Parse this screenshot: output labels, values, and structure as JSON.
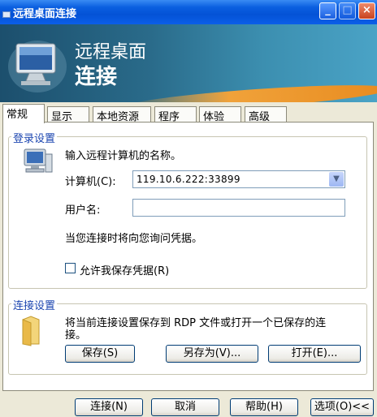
{
  "window": {
    "title": "远程桌面连接"
  },
  "banner": {
    "line1": "远程桌面",
    "line2": "连接"
  },
  "tabs": [
    {
      "label": "常规",
      "active": true
    },
    {
      "label": "显示",
      "active": false
    },
    {
      "label": "本地资源",
      "active": false
    },
    {
      "label": "程序",
      "active": false
    },
    {
      "label": "体验",
      "active": false
    },
    {
      "label": "高级",
      "active": false
    }
  ],
  "login": {
    "group_title": "登录设置",
    "instruction": "输入远程计算机的名称。",
    "computer_label": "计算机(C):",
    "computer_value": "119.10.6.222:33899",
    "username_label": "用户名:",
    "username_value": "",
    "note": "当您连接时将向您询问凭据。",
    "allow_save_label": "允许我保存凭据(R)",
    "allow_save_checked": false
  },
  "connection": {
    "group_title": "连接设置",
    "description_line1": "将当前连接设置保存到 RDP 文件或打开一个已保存的连",
    "description_line2": "接。",
    "save_label": "保存(S)",
    "save_as_label": "另存为(V)...",
    "open_label": "打开(E)..."
  },
  "footer": {
    "connect_label": "连接(N)",
    "cancel_label": "取消",
    "help_label": "帮助(H)",
    "options_label": "选项(O)<<"
  }
}
